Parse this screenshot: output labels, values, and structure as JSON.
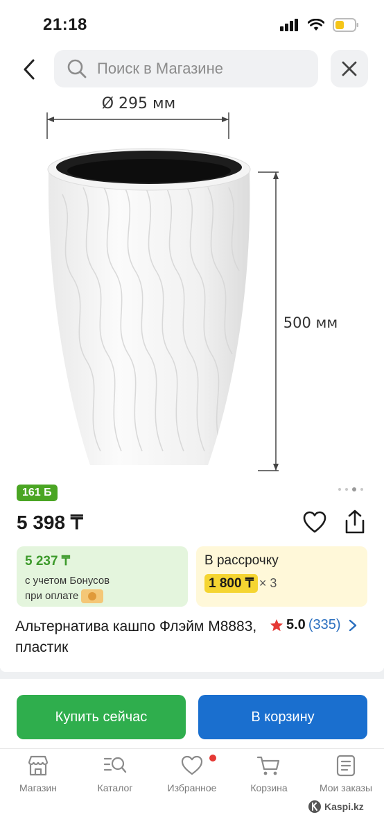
{
  "status_bar": {
    "time": "21:18",
    "battery_color": "#f5c518"
  },
  "search": {
    "placeholder": "Поиск в Магазине",
    "back_icon": "chevron-left-icon",
    "clear_icon": "close-icon"
  },
  "product_image": {
    "diameter_label": "Ø 295 мм",
    "height_label": "500 мм",
    "slide_index": 2,
    "slide_count": 4
  },
  "product": {
    "bonus_badge": "161 Б",
    "price": "5 398 ₸",
    "title": "Альтернатива кашпо Флэйм М8883, пластик",
    "rating_value": "5.0",
    "rating_count": "(335)"
  },
  "bonus_card": {
    "price": "5 237 ₸",
    "line1": "с учетом Бонусов",
    "line2": "при оплате"
  },
  "installment_card": {
    "title": "В рассрочку",
    "amount": "1 800 ₸",
    "multiplier": "× 3"
  },
  "actions": {
    "buy_now": "Купить сейчас",
    "add_to_cart": "В корзину"
  },
  "tabbar": {
    "items": [
      {
        "label": "Магазин",
        "icon": "store-icon"
      },
      {
        "label": "Каталог",
        "icon": "catalog-search-icon"
      },
      {
        "label": "Избранное",
        "icon": "heart-icon"
      },
      {
        "label": "Корзина",
        "icon": "cart-icon"
      },
      {
        "label": "Мои заказы",
        "icon": "orders-icon"
      }
    ]
  },
  "brand": "Kaspi.kz",
  "colors": {
    "bonus_green": "#4aa523",
    "buy_green": "#2fae4d",
    "cart_blue": "#1a6fcf",
    "installment_yellow": "#f5d531",
    "rating_star": "#e53935"
  }
}
